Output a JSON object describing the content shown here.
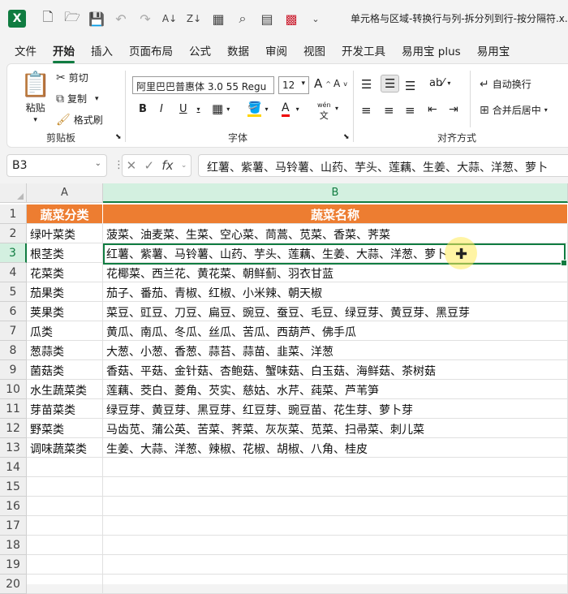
{
  "window": {
    "title": "单元格与区域-转换行与列-拆分列到行-按分隔符.x..."
  },
  "quick_access": {
    "icons": [
      "new-file-icon",
      "open-folder-icon",
      "save-icon",
      "undo-icon",
      "redo-icon",
      "sort-asc-icon",
      "sort-desc-icon",
      "borders-icon",
      "find-icon",
      "form-icon",
      "clear-icon",
      "more-icon"
    ]
  },
  "menu": {
    "tabs": [
      "文件",
      "开始",
      "插入",
      "页面布局",
      "公式",
      "数据",
      "审阅",
      "视图",
      "开发工具",
      "易用宝 plus",
      "易用宝"
    ],
    "active": "开始"
  },
  "ribbon": {
    "clipboard": {
      "paste": "粘贴",
      "cut": "剪切",
      "copy": "复制",
      "format_painter": "格式刷",
      "label": "剪贴板"
    },
    "font": {
      "name": "阿里巴巴普惠体 3.0 55 Regu",
      "size": "12",
      "label": "字体",
      "bold": "B",
      "italic": "I",
      "underline": "U",
      "font_color": "A",
      "grow": "A",
      "shrink": "A",
      "pinyin": "wén"
    },
    "alignment": {
      "wrap_text": "自动换行",
      "merge_center": "合并后居中",
      "label": "对齐方式"
    }
  },
  "formula_bar": {
    "name_box": "B3",
    "fx": "fx",
    "content": "红薯、紫薯、马铃薯、山药、芋头、莲藕、生姜、大蒜、洋葱、萝卜"
  },
  "sheet": {
    "columns": [
      "A",
      "B"
    ],
    "rows": [
      [
        "蔬菜分类",
        "蔬菜名称"
      ],
      [
        "绿叶菜类",
        "菠菜、油麦菜、生菜、空心菜、茼蒿、苋菜、香菜、荠菜"
      ],
      [
        "根茎类",
        "红薯、紫薯、马铃薯、山药、芋头、莲藕、生姜、大蒜、洋葱、萝卜"
      ],
      [
        "花菜类",
        "花椰菜、西兰花、黄花菜、朝鲜蓟、羽衣甘蓝"
      ],
      [
        "茄果类",
        "茄子、番茄、青椒、红椒、小米辣、朝天椒"
      ],
      [
        "荚果类",
        "菜豆、豇豆、刀豆、扁豆、豌豆、蚕豆、毛豆、绿豆芽、黄豆芽、黑豆芽"
      ],
      [
        "瓜类",
        "黄瓜、南瓜、冬瓜、丝瓜、苦瓜、西葫芦、佛手瓜"
      ],
      [
        "葱蒜类",
        "大葱、小葱、香葱、蒜苔、蒜苗、韭菜、洋葱"
      ],
      [
        "菌菇类",
        "香菇、平菇、金针菇、杏鲍菇、蟹味菇、白玉菇、海鲜菇、茶树菇"
      ],
      [
        "水生蔬菜类",
        "莲藕、茭白、菱角、芡实、慈姑、水芹、莼菜、芦苇笋"
      ],
      [
        "芽苗菜类",
        "绿豆芽、黄豆芽、黑豆芽、红豆芽、豌豆苗、花生芽、萝卜芽"
      ],
      [
        "野菜类",
        "马齿苋、蒲公英、苦菜、荠菜、灰灰菜、苋菜、扫帚菜、刺儿菜"
      ],
      [
        "调味蔬菜类",
        "生姜、大蒜、洋葱、辣椒、花椒、胡椒、八角、桂皮"
      ],
      [
        "",
        ""
      ],
      [
        "",
        ""
      ],
      [
        "",
        ""
      ],
      [
        "",
        ""
      ],
      [
        "",
        ""
      ],
      [
        "",
        ""
      ],
      [
        "",
        ""
      ]
    ],
    "row_numbers": [
      "1",
      "2",
      "3",
      "4",
      "5",
      "6",
      "7",
      "8",
      "9",
      "10",
      "11",
      "12",
      "13",
      "14",
      "15",
      "16",
      "17",
      "18",
      "19",
      "20"
    ],
    "selected_cell": "B3",
    "colors": {
      "header_fill": "#ed7d31",
      "accent": "#107c41"
    }
  }
}
